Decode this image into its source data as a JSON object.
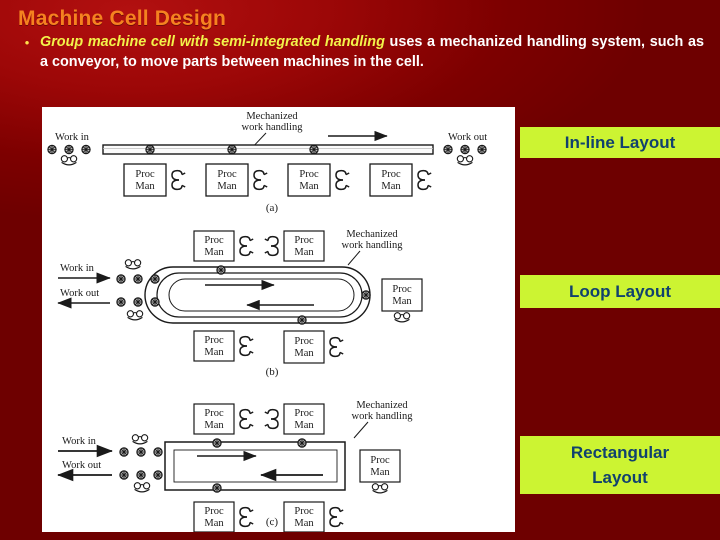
{
  "slide": {
    "title": "Machine Cell Design",
    "bullet_marker": "•",
    "bullet": {
      "emphasis": "Group machine cell with semi-integrated handling",
      "rest": " uses a mechanized handling system, such as a conveyor, to move parts between machines in the cell."
    },
    "colors": {
      "background_red": "#7d0000",
      "background_highlight": "#b21010",
      "title_orange": "#f58220",
      "emphasis_yellow": "#f2f24a",
      "body_white": "#ffffff",
      "label_fill": "#ccf432",
      "label_text": "#11416e",
      "figure_bg": "#ffffff",
      "figure_ink": "#1a1a1a"
    }
  },
  "labels": {
    "inline": "In-line Layout",
    "loop": "Loop Layout",
    "rectangular_line1": "Rectangular",
    "rectangular_line2": "Layout"
  },
  "figure": {
    "caption_a": "(a)",
    "caption_b": "(b)",
    "caption_c": "(c)",
    "texts": {
      "mechanized": "Mechanized",
      "work_handling": "work handling",
      "work_in": "Work in",
      "work_out": "Work out",
      "proc": "Proc",
      "man": "Man"
    },
    "panels": [
      {
        "id": "a",
        "name": "in-line-layout",
        "caption": "(a)",
        "handling_label": [
          "Mechanized",
          "work handling"
        ],
        "flow_in": "Work in",
        "flow_out": "Work out",
        "stations": [
          {
            "label": [
              "Proc",
              "Man"
            ]
          },
          {
            "label": [
              "Proc",
              "Man"
            ]
          },
          {
            "label": [
              "Proc",
              "Man"
            ]
          },
          {
            "label": [
              "Proc",
              "Man"
            ]
          }
        ],
        "station_count": 4,
        "conveyor_direction": "left-to-right"
      },
      {
        "id": "b",
        "name": "loop-layout",
        "caption": "(b)",
        "handling_label": [
          "Mechanized",
          "work handling"
        ],
        "flow_in": "Work in",
        "flow_out": "Work out",
        "stations": [
          {
            "label": [
              "Proc",
              "Man"
            ],
            "position": "top-left"
          },
          {
            "label": [
              "Proc",
              "Man"
            ],
            "position": "top-right"
          },
          {
            "label": [
              "Proc",
              "Man"
            ],
            "position": "right"
          },
          {
            "label": [
              "Proc",
              "Man"
            ],
            "position": "bottom-left"
          },
          {
            "label": [
              "Proc",
              "Man"
            ],
            "position": "bottom-right"
          }
        ],
        "station_count": 5,
        "conveyor_direction": "clockwise-loop"
      },
      {
        "id": "c",
        "name": "rectangular-layout",
        "caption": "(c)",
        "handling_label": [
          "Mechanized",
          "work handling"
        ],
        "flow_in": "Work in",
        "flow_out": "Work out",
        "stations": [
          {
            "label": [
              "Proc",
              "Man"
            ],
            "position": "top-left"
          },
          {
            "label": [
              "Proc",
              "Man"
            ],
            "position": "top-right"
          },
          {
            "label": [
              "Proc",
              "Man"
            ],
            "position": "right"
          },
          {
            "label": [
              "Proc",
              "Man"
            ],
            "position": "bottom-left"
          },
          {
            "label": [
              "Proc",
              "Man"
            ],
            "position": "bottom-right"
          }
        ],
        "station_count": 5,
        "conveyor_direction": "clockwise-rectangle"
      }
    ]
  }
}
